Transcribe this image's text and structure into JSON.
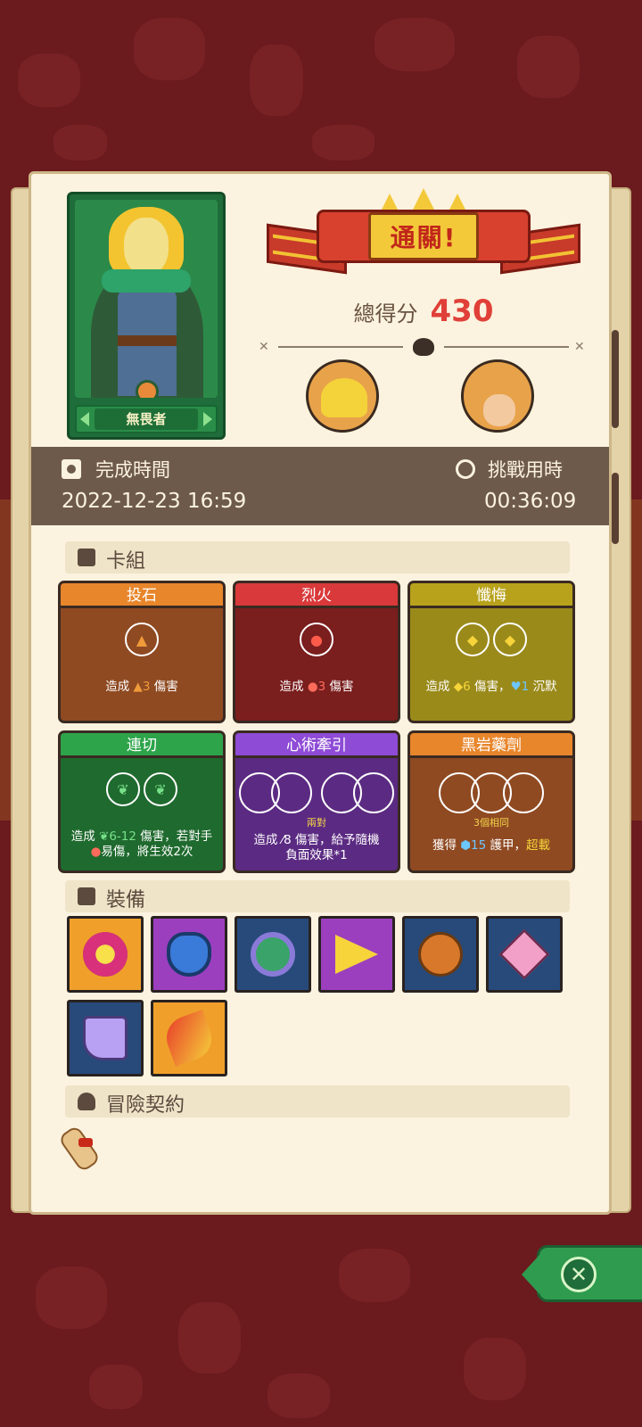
{
  "hero": {
    "name": "無畏者"
  },
  "result": {
    "banner": "通關!",
    "score_label": "總得分",
    "score_value": "430"
  },
  "time": {
    "finish_label": "完成時間",
    "finish_value": "2022-12-23 16:59",
    "duration_label": "挑戰用時",
    "duration_value": "00:36:09"
  },
  "deck": {
    "title": "卡組",
    "cards": [
      {
        "name": "投石",
        "head_color": "#e8862b",
        "body_color": "#8f4a22",
        "desc_pre": "造成 ",
        "desc_val": "3",
        "desc_post": " 傷害",
        "sub": ""
      },
      {
        "name": "烈火",
        "head_color": "#d9393a",
        "body_color": "#7a1e1e",
        "desc_pre": "造成 ",
        "desc_val": "3",
        "desc_post": " 傷害",
        "sub": ""
      },
      {
        "name": "懺悔",
        "head_color": "#b8a21c",
        "body_color": "#9a8a1a",
        "desc_pre": "造成 ",
        "desc_val": "6",
        "desc_post": " 傷害，",
        "desc_val2": "1",
        "desc_post2": " 沉默",
        "sub": ""
      },
      {
        "name": "連切",
        "head_color": "#2ea44a",
        "body_color": "#1f6a2e",
        "desc_pre": "造成 ",
        "desc_val": "6-12",
        "desc_post": " 傷害，若對手",
        "desc_line2": "易傷，將生效2次",
        "sub": ""
      },
      {
        "name": "心術牽引",
        "head_color": "#8e4bd6",
        "body_color": "#5b2a82",
        "desc_line1": "造成 ⁄8 傷害，給予隨機",
        "desc_line2": "負面效果*1",
        "sub": "兩對"
      },
      {
        "name": "黑岩藥劑",
        "head_color": "#e8862b",
        "body_color": "#8f4a22",
        "desc_pre": "獲得 ",
        "desc_val": "15",
        "desc_post": " 護甲，",
        "desc_extra": "超載",
        "sub": "3個相同"
      }
    ]
  },
  "equipment": {
    "title": "裝備",
    "items": [
      {
        "icon": "magic-orb-icon",
        "bg": "#f0a02a"
      },
      {
        "icon": "shield-crest-icon",
        "bg": "#9b3fbf"
      },
      {
        "icon": "leaf-ring-icon",
        "bg": "#274a7a"
      },
      {
        "icon": "cheese-wedge-icon",
        "bg": "#9b3fbf"
      },
      {
        "icon": "seed-pot-icon",
        "bg": "#274a7a"
      },
      {
        "icon": "crystal-die-icon",
        "bg": "#274a7a"
      },
      {
        "icon": "crystal-boot-icon",
        "bg": "#274a7a"
      },
      {
        "icon": "fire-feather-icon",
        "bg": "#f0a02a"
      }
    ]
  },
  "contract": {
    "title": "冒險契約",
    "icon": "scroll-icon"
  },
  "close": {
    "icon": "close-icon"
  }
}
